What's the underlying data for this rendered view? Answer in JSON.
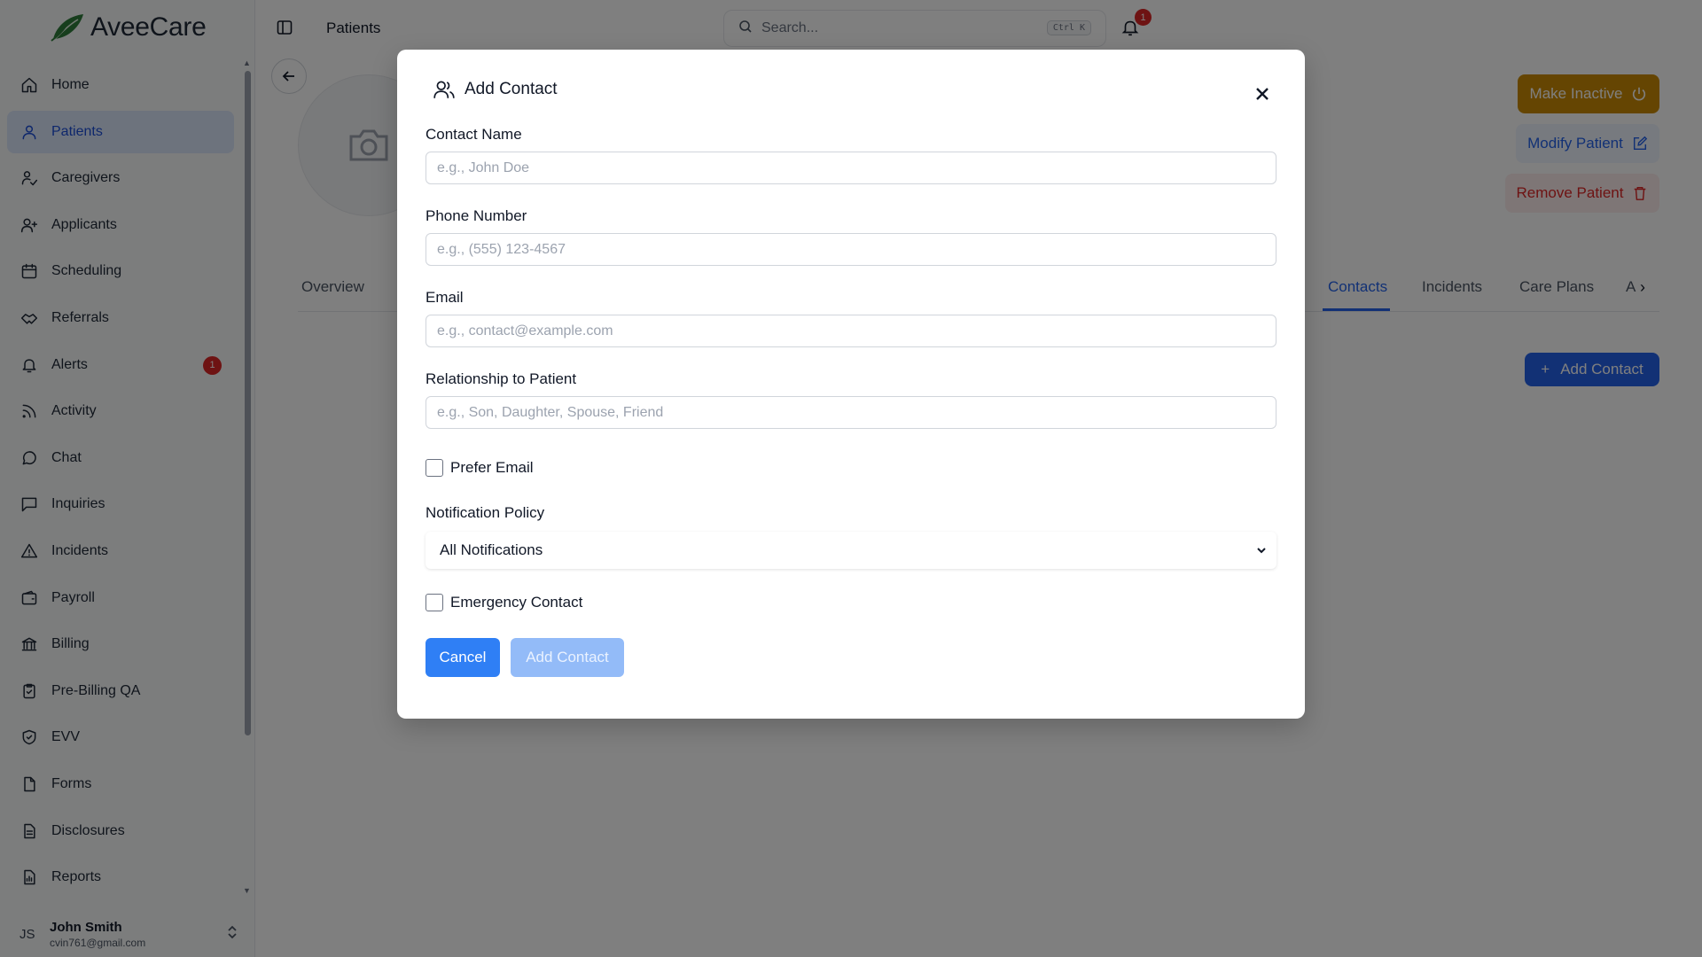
{
  "app": {
    "name": "AveeCare"
  },
  "sidebar": {
    "items": [
      {
        "label": "Home",
        "icon": "home-icon"
      },
      {
        "label": "Patients",
        "icon": "user-icon",
        "active": true
      },
      {
        "label": "Caregivers",
        "icon": "caregiver-icon"
      },
      {
        "label": "Applicants",
        "icon": "user-plus-icon"
      },
      {
        "label": "Scheduling",
        "icon": "calendar-icon"
      },
      {
        "label": "Referrals",
        "icon": "handshake-icon"
      },
      {
        "label": "Alerts",
        "icon": "bell-icon",
        "badge": "1"
      },
      {
        "label": "Activity",
        "icon": "rss-icon"
      },
      {
        "label": "Chat",
        "icon": "chat-bubble-icon"
      },
      {
        "label": "Inquiries",
        "icon": "message-square-icon"
      },
      {
        "label": "Incidents",
        "icon": "warning-triangle-icon"
      },
      {
        "label": "Payroll",
        "icon": "wallet-icon"
      },
      {
        "label": "Billing",
        "icon": "bank-icon"
      },
      {
        "label": "Pre-Billing QA",
        "icon": "clipboard-check-icon"
      },
      {
        "label": "EVV",
        "icon": "shield-check-icon"
      },
      {
        "label": "Forms",
        "icon": "document-icon"
      },
      {
        "label": "Disclosures",
        "icon": "document-lines-icon"
      },
      {
        "label": "Reports",
        "icon": "report-icon"
      }
    ],
    "user": {
      "initials": "JS",
      "name": "John Smith",
      "email": "cvin761@gmail.com"
    }
  },
  "header": {
    "breadcrumb": "Patients",
    "search_placeholder": "Search...",
    "search_shortcut": "Ctrl K",
    "notification_count": "1"
  },
  "patient_actions": {
    "make_inactive": "Make Inactive",
    "modify": "Modify Patient",
    "remove": "Remove Patient"
  },
  "tabs": {
    "overview": "Overview",
    "contacts": "Contacts",
    "incidents": "Incidents",
    "care_plans": "Care Plans",
    "truncated": "A"
  },
  "contacts_panel": {
    "add_button": "Add Contact"
  },
  "modal": {
    "title": "Add Contact",
    "fields": {
      "contact_name": {
        "label": "Contact Name",
        "placeholder": "e.g., John Doe",
        "value": ""
      },
      "phone": {
        "label": "Phone Number",
        "placeholder": "e.g., (555) 123-4567",
        "value": ""
      },
      "email": {
        "label": "Email",
        "placeholder": "e.g., contact@example.com",
        "value": ""
      },
      "relationship": {
        "label": "Relationship to Patient",
        "placeholder": "e.g., Son, Daughter, Spouse, Friend",
        "value": ""
      }
    },
    "prefer_email": {
      "label": "Prefer Email",
      "checked": false
    },
    "notification_policy": {
      "label": "Notification Policy",
      "selected": "All Notifications"
    },
    "emergency_contact": {
      "label": "Emergency Contact",
      "checked": false
    },
    "cancel": "Cancel",
    "submit": "Add Contact"
  },
  "colors": {
    "primary": "#2563eb",
    "warning": "#ca8a04",
    "danger": "#dc2626",
    "active_nav_bg": "#dbe7fb",
    "logo_green": "#2f7d3a"
  }
}
